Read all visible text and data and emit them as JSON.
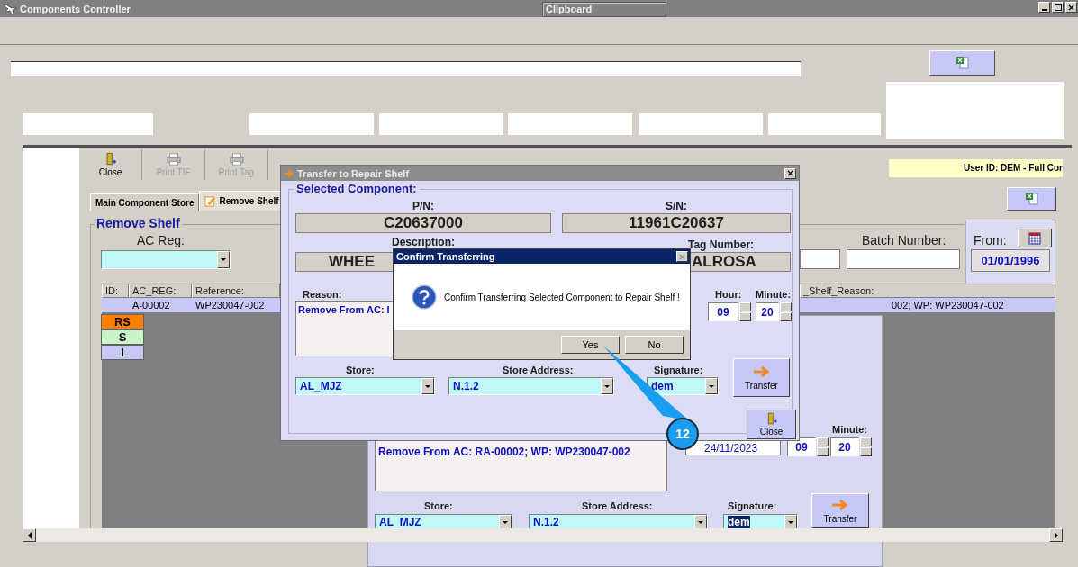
{
  "main_window": {
    "title": "Components Controller",
    "clipboard_tab": "Clipboard",
    "user_id": "User ID: DEM - Full Cor"
  },
  "toolbar": [
    {
      "label": "Close",
      "kind": "door",
      "disabled": false
    },
    {
      "label": "Print TIF",
      "kind": "printer",
      "disabled": true
    },
    {
      "label": "Print Tag",
      "kind": "printer",
      "disabled": true
    }
  ],
  "tabs": [
    {
      "label": "Main Component Store",
      "selected": false
    },
    {
      "label": "Remove Shelf",
      "selected": true
    }
  ],
  "remove_shelf": {
    "title": "Remove Shelf",
    "ac_reg_label": "AC Reg:",
    "batch_label": "Batch Number:",
    "from_label": "From:",
    "from_date": "01/01/1996",
    "columns": [
      "ID:",
      "AC_REG:",
      "Reference:"
    ],
    "right_column": "_Shelf_Reason:",
    "rows": [
      {
        "ac_reg": "A-00002",
        "reference": "WP230047-002",
        "reason": "002; WP: WP230047-002",
        "selected": true
      }
    ]
  },
  "status_legend": [
    {
      "label": "RS",
      "color": "#ff8000"
    },
    {
      "label": "S",
      "color": "#c8f4c8"
    },
    {
      "label": "I",
      "color": "#c8c8f4"
    }
  ],
  "transfer_dialog": {
    "title": "Transfer to Repair Shelf",
    "group": "Selected Component:",
    "pn_label": "P/N:",
    "pn": "C20637000",
    "sn_label": "S/N:",
    "sn": "11961C20637",
    "description_label": "Description:",
    "description": "WHEE",
    "tag_label": "Tag Number:",
    "tag": "ALROSA",
    "reason_label": "Reason:",
    "reason": "Remove From AC: I",
    "hour_label": "Hour:",
    "hour": "09",
    "minute_label": "Minute:",
    "minute": "20",
    "store_label": "Store:",
    "store": "AL_MJZ",
    "address_label": "Store Address:",
    "address": "N.1.2",
    "signature_label": "Signature:",
    "signature": "dem",
    "transfer": "Transfer",
    "close": "Close"
  },
  "rear_dialog": {
    "reason": "Remove From AC: RA-00002; WP: WP230047-002",
    "date": "24/11/2023",
    "hour": "09",
    "minute_label": "Minute:",
    "minute": "20",
    "store_label": "Store:",
    "store": "AL_MJZ",
    "address_label": "Store Address:",
    "address": "N.1.2",
    "signature_label": "Signature:",
    "signature": "dem",
    "transfer": "Transfer"
  },
  "confirm": {
    "title": "Confirm Transferring",
    "message": "Confirm Transferring Selected Component to Repair Shelf !",
    "buttons": [
      "Yes",
      "No"
    ]
  },
  "callout": {
    "number": "12"
  }
}
